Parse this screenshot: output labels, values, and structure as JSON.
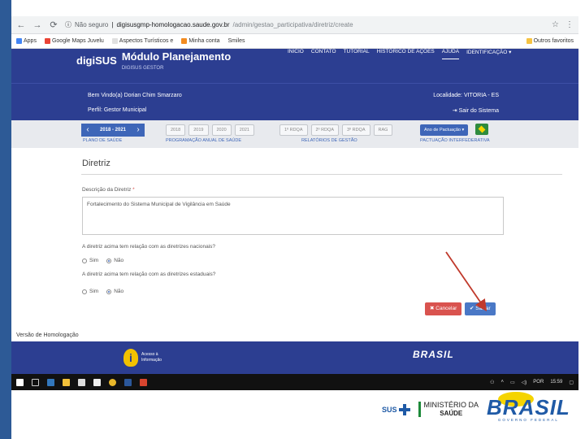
{
  "browser": {
    "security": "Não seguro",
    "url_host": "digisusgmp-homologacao.saude.gov.br",
    "url_path": "/admin/gestao_participativa/diretriz/create"
  },
  "bookmarks": {
    "items": [
      "Apps",
      "Google Maps Juvelu",
      "Aspectos Turísticos e",
      "Minha conta",
      "Smiles"
    ],
    "right_label": "Outros favoritos"
  },
  "header": {
    "logo_text": "digiSUS",
    "title": "Módulo Planejamento",
    "subtitle": "DIGISUS GESTOR",
    "nav": [
      "INICIO",
      "CONTATO",
      "TUTORIAL",
      "HISTÓRICO DE AÇÕES",
      "AJUDA",
      "IDENTIFICAÇÃO ▾"
    ]
  },
  "user": {
    "welcome": "Bem Vindo(a) Dorian Chim Smarzaro",
    "profile": "Perfil: Gestor Municipal",
    "locality": "Localidade: VITORIA - ES",
    "logout": "Sair do Sistema"
  },
  "navband": {
    "year_range": "2018 - 2021",
    "year_prev": "‹",
    "year_next": "›",
    "plano_label": "PLANO DE SAÚDE",
    "years": [
      "2018",
      "2019",
      "2020",
      "2021"
    ],
    "programacao_label": "PROGRAMAÇÃO ANUAL DE SAÚDE",
    "reports": [
      "1º RDQA",
      "2º RDQA",
      "3º RDQA",
      "RAG"
    ],
    "relatorios_label": "RELATÓRIOS DE GESTÃO",
    "ano_pactuacao": "Ano de Pactuação ▾",
    "pactuacao_label": "PACTUAÇÃO INTERFEDERATIVA"
  },
  "form": {
    "section_title": "Diretriz",
    "description_label": "Descrição da Diretriz",
    "required_mark": "*",
    "description_value": "Fortalecimento do Sistema Municipal de Vigilância em Saúde",
    "q_national": "A diretriz acima tem relação com as diretrizes nacionais?",
    "q_state": "A diretriz acima tem relação com as diretrizes estaduais?",
    "opt_yes": "Sim",
    "opt_no": "Não",
    "cancel_label": "✖ Cancelar",
    "save_label": "✔ Salvar"
  },
  "homologacao": "Versão de Homologação",
  "footer": {
    "info_text_1": "Acesso à",
    "info_text_2": "Informação",
    "brasil": "BRASIL"
  },
  "taskbar": {
    "lang": "POR",
    "time": "15:59"
  },
  "slide_logos": {
    "sus": "SUS",
    "ministerio_1": "MINISTÉRIO DA",
    "ministerio_2": "SAÚDE",
    "brasil": "BRASIL",
    "brasil_sub": "GOVERNO FEDERAL"
  },
  "colors": {
    "header_blue": "#2c3e91",
    "accent_blue": "#3e66b8",
    "cancel_red": "#d9534f",
    "annotation_arrow": "#c0392b"
  }
}
